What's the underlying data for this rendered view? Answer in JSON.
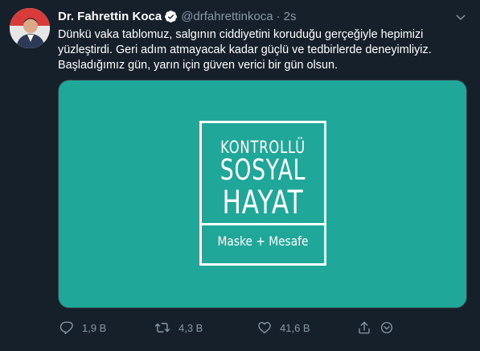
{
  "tweet": {
    "author_name": "Dr. Fahrettin Koca",
    "handle": "@drfahrettinkoca",
    "separator": "·",
    "time": "2s",
    "text_lines": [
      "Dünkü vaka tablomuz, salgının ciddiyetini koruduğu gerçeğiyle hepimizi",
      "yüzleştirdi. Geri adım atmayacak kadar güçlü ve tedbirlerde deneyimliyiz.",
      "Başladığımız gün, yarın için güven verici bir gün olsun."
    ]
  },
  "media": {
    "background_color": "#1fa89a",
    "logo_line1": "KONTROLLÜ",
    "logo_line2": "SOSYAL",
    "logo_line3": "HAYAT",
    "logo_tagline": "Maske + Mesafe"
  },
  "actions": {
    "reply_count": "1,9 B",
    "retweet_count": "4,3 B",
    "like_count": "41,6 B"
  },
  "icons": {
    "verified": "verified-badge-icon",
    "caret": "chevron-down-icon",
    "reply": "reply-icon",
    "retweet": "retweet-icon",
    "like": "heart-icon",
    "share": "share-icon",
    "bookmark": "bookmark-icon"
  },
  "colors": {
    "background": "#15202b",
    "secondary_text": "#8899a6",
    "accent": "#1da1f2"
  }
}
